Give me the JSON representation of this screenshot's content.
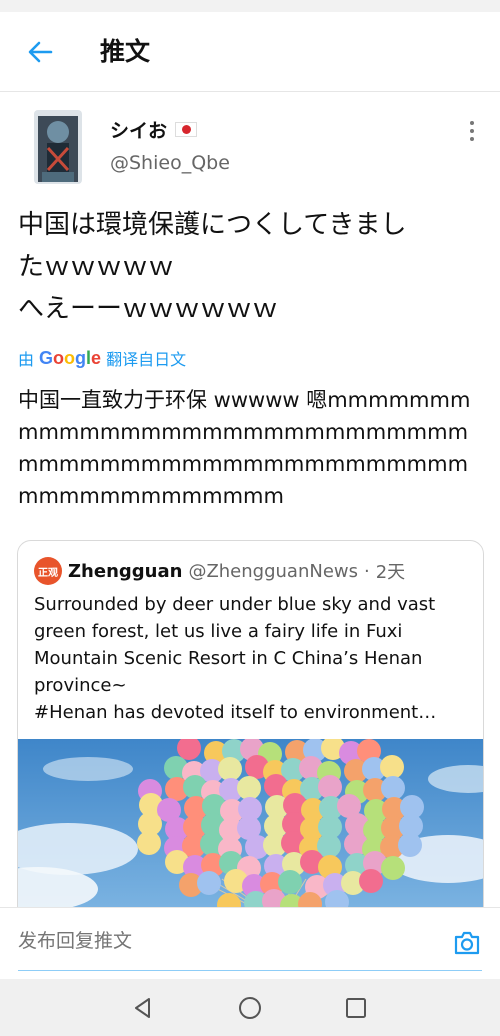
{
  "header": {
    "title": "推文",
    "back_icon": "arrow-left-icon",
    "accent_color": "#1d9bf0"
  },
  "tweet": {
    "author": {
      "display_name": "シイお",
      "flag_icon": "japan-flag-icon",
      "handle": "@Shieo_Qbe"
    },
    "text": "中国は環境保護につくしてきまし\nたｗｗｗｗｗ\nへえーーｗｗｗｗｗｗ",
    "translation": {
      "prefix": "由",
      "provider": "Google",
      "suffix": "翻译自日文"
    },
    "translated_text": "中国一直致力于环保 wwwww 嗯mmmmmmmmmmmmmmmmmmmmmmmmmmmmmmmmmmmmmmmmmmmmmmmmmmmmmmmmmmmmmmmm"
  },
  "quote": {
    "avatar_label": "正观",
    "name": "Zhengguan",
    "handle": "@ZhengguanNews",
    "separator": "·",
    "time": "2天",
    "text_lines": [
      "Surrounded by deer under blue sky and vast",
      "green forest, let us live a fairy life in Fuxi",
      "Mountain Scenic Resort in C China’s Henan",
      "province~",
      "#Henan has devoted itself to environment…"
    ],
    "media_description_icon": "balloon-photo"
  },
  "reply": {
    "placeholder": "发布回复推文",
    "camera_icon": "camera-icon"
  },
  "navigation": {
    "back_icon": "triangle-back-icon",
    "home_icon": "circle-home-icon",
    "recents_icon": "square-recents-icon"
  }
}
